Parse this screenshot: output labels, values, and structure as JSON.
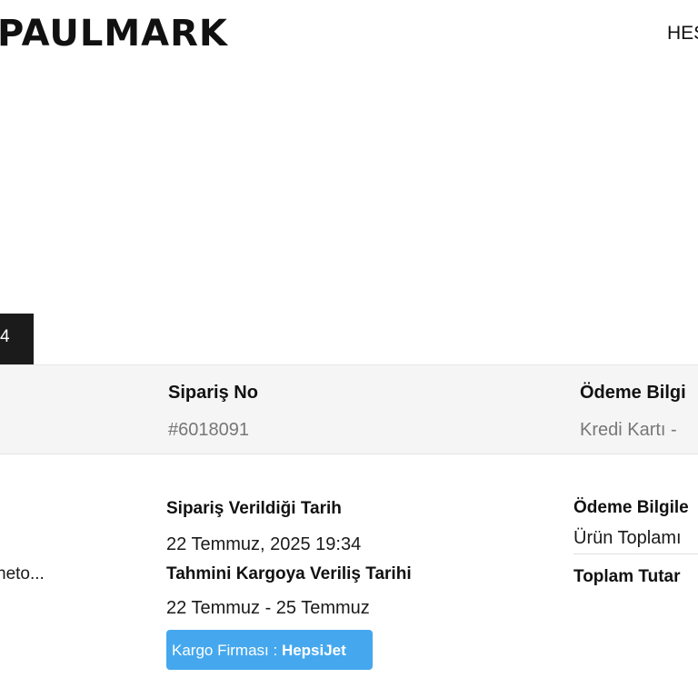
{
  "brand": {
    "logo_text": "PAULMARK"
  },
  "nav": {
    "item_text": "HES"
  },
  "tabs": {
    "active_label": "4"
  },
  "order": {
    "order_no_label": "Sipariş No",
    "order_no_value": "#6018091",
    "payment_info_label": "Ödeme Bilgi",
    "payment_info_value": "Kredi Kartı -"
  },
  "detail": {
    "product_name": "neto...",
    "order_date_label": "Sipariş Verildiği Tarih",
    "order_date_value": "22 Temmuz, 2025 19:34",
    "ship_est_label": "Tahmini Kargoya Veriliş Tarihi",
    "ship_est_value": "22 Temmuz - 25 Temmuz",
    "cargo_label": "Kargo Firması :",
    "cargo_value": "HepsiJet",
    "payment_info_label": "Ödeme Bilgile",
    "subtotal_label": "Ürün Toplamı",
    "total_label": "Toplam Tutar"
  },
  "colors": {
    "cargo_badge": "#45a8ee",
    "active_tab": "#1b1b1b",
    "header_bg": "#f5f5f5"
  }
}
